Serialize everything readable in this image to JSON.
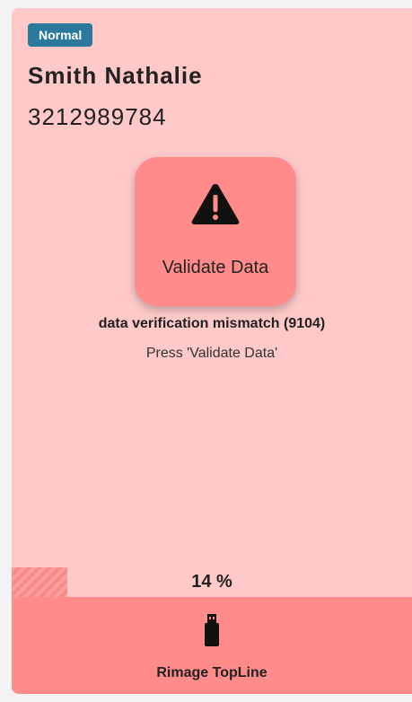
{
  "job": {
    "priority": "Normal",
    "name": "Smith Nathalie",
    "id": "3212989784"
  },
  "action": {
    "icon": "warning-icon",
    "label": "Validate Data"
  },
  "status": {
    "error": "data verification mismatch (9104)",
    "instruction": "Press 'Validate Data'"
  },
  "progress": {
    "percent": 14,
    "label": "14 %"
  },
  "device": {
    "icon": "usb-drive-icon",
    "name": "Rimage TopLine"
  },
  "colors": {
    "card_background": "#ffc9c9",
    "accent": "#ff8b8b",
    "badge": "#2b7a9e"
  }
}
